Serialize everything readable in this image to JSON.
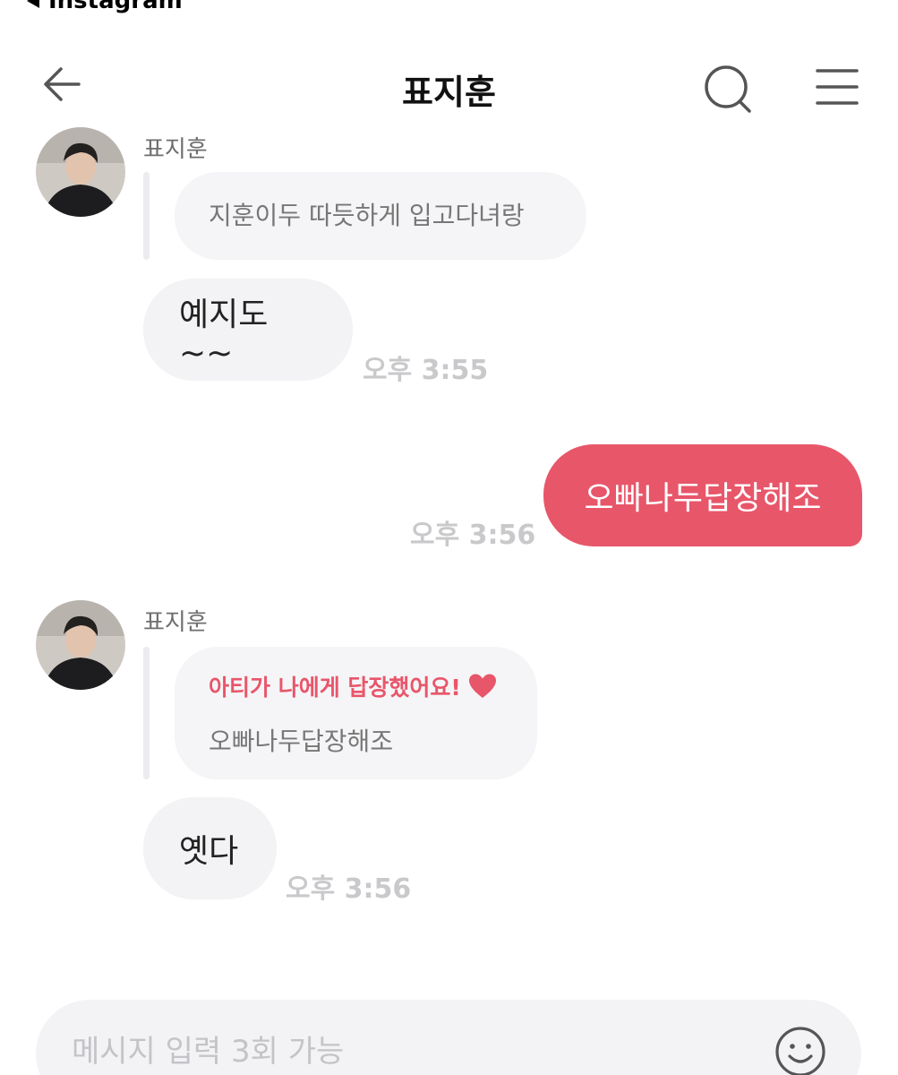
{
  "status": {
    "back_app": "Instagram"
  },
  "header": {
    "title": "표지훈"
  },
  "messages": {
    "m1": {
      "sender": "표지훈",
      "quote": "지훈이두 따듯하게 입고다녀랑",
      "text": "예지도~~",
      "time": "오후 3:55"
    },
    "m2": {
      "text": "오빠나두답장해조",
      "time": "오후 3:56"
    },
    "m3": {
      "sender": "표지훈",
      "reply_notice": "아티가 나에게 답장했어요!",
      "quote": "오빠나두답장해조",
      "text": "옛다",
      "time": "오후 3:56"
    }
  },
  "composer": {
    "placeholder": "메시지 입력 3회 가능"
  },
  "colors": {
    "accent": "#e8566a",
    "heart": "#e8566a",
    "bubble_in": "#f3f3f5",
    "quote_bg": "#f5f5f7"
  }
}
